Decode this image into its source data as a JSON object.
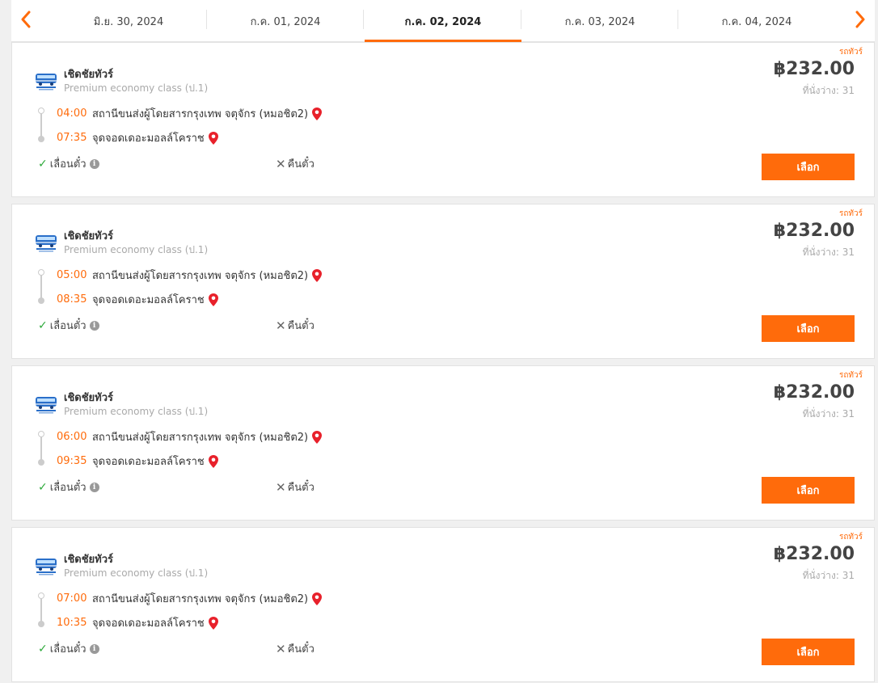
{
  "dates": [
    {
      "label": "มิ.ย. 30, 2024",
      "active": false
    },
    {
      "label": "ก.ค. 01, 2024",
      "active": false
    },
    {
      "label": "ก.ค. 02, 2024",
      "active": true
    },
    {
      "label": "ก.ค. 03, 2024",
      "active": false
    },
    {
      "label": "ก.ค. 04, 2024",
      "active": false
    }
  ],
  "colors": {
    "accent": "#ff6b0b",
    "check": "#2eaa3c",
    "pin": "#e8212b"
  },
  "trips": [
    {
      "tag": "รถทัวร์",
      "operator": "เชิดชัยทัวร์",
      "bus_class": "Premium economy class (ป.1)",
      "dep_time": "04:00",
      "dep_stop": "สถานีขนส่งผู้โดยสารกรุงเทพ จตุจักร (หมอชิต2)",
      "arr_time": "07:35",
      "arr_stop": "จุดจอดเดอะมอลล์โคราช",
      "change_label": "เลื่อนตั๋ว",
      "refund_label": "คืนตั๋ว",
      "price": "฿232.00",
      "seats": "ที่นั่งว่าง: 31",
      "select_label": "เลือก"
    },
    {
      "tag": "รถทัวร์",
      "operator": "เชิดชัยทัวร์",
      "bus_class": "Premium economy class (ป.1)",
      "dep_time": "05:00",
      "dep_stop": "สถานีขนส่งผู้โดยสารกรุงเทพ จตุจักร (หมอชิต2)",
      "arr_time": "08:35",
      "arr_stop": "จุดจอดเดอะมอลล์โคราช",
      "change_label": "เลื่อนตั๋ว",
      "refund_label": "คืนตั๋ว",
      "price": "฿232.00",
      "seats": "ที่นั่งว่าง: 31",
      "select_label": "เลือก"
    },
    {
      "tag": "รถทัวร์",
      "operator": "เชิดชัยทัวร์",
      "bus_class": "Premium economy class (ป.1)",
      "dep_time": "06:00",
      "dep_stop": "สถานีขนส่งผู้โดยสารกรุงเทพ จตุจักร (หมอชิต2)",
      "arr_time": "09:35",
      "arr_stop": "จุดจอดเดอะมอลล์โคราช",
      "change_label": "เลื่อนตั๋ว",
      "refund_label": "คืนตั๋ว",
      "price": "฿232.00",
      "seats": "ที่นั่งว่าง: 31",
      "select_label": "เลือก"
    },
    {
      "tag": "รถทัวร์",
      "operator": "เชิดชัยทัวร์",
      "bus_class": "Premium economy class (ป.1)",
      "dep_time": "07:00",
      "dep_stop": "สถานีขนส่งผู้โดยสารกรุงเทพ จตุจักร (หมอชิต2)",
      "arr_time": "10:35",
      "arr_stop": "จุดจอดเดอะมอลล์โคราช",
      "change_label": "เลื่อนตั๋ว",
      "refund_label": "คืนตั๋ว",
      "price": "฿232.00",
      "seats": "ที่นั่งว่าง: 31",
      "select_label": "เลือก"
    }
  ]
}
